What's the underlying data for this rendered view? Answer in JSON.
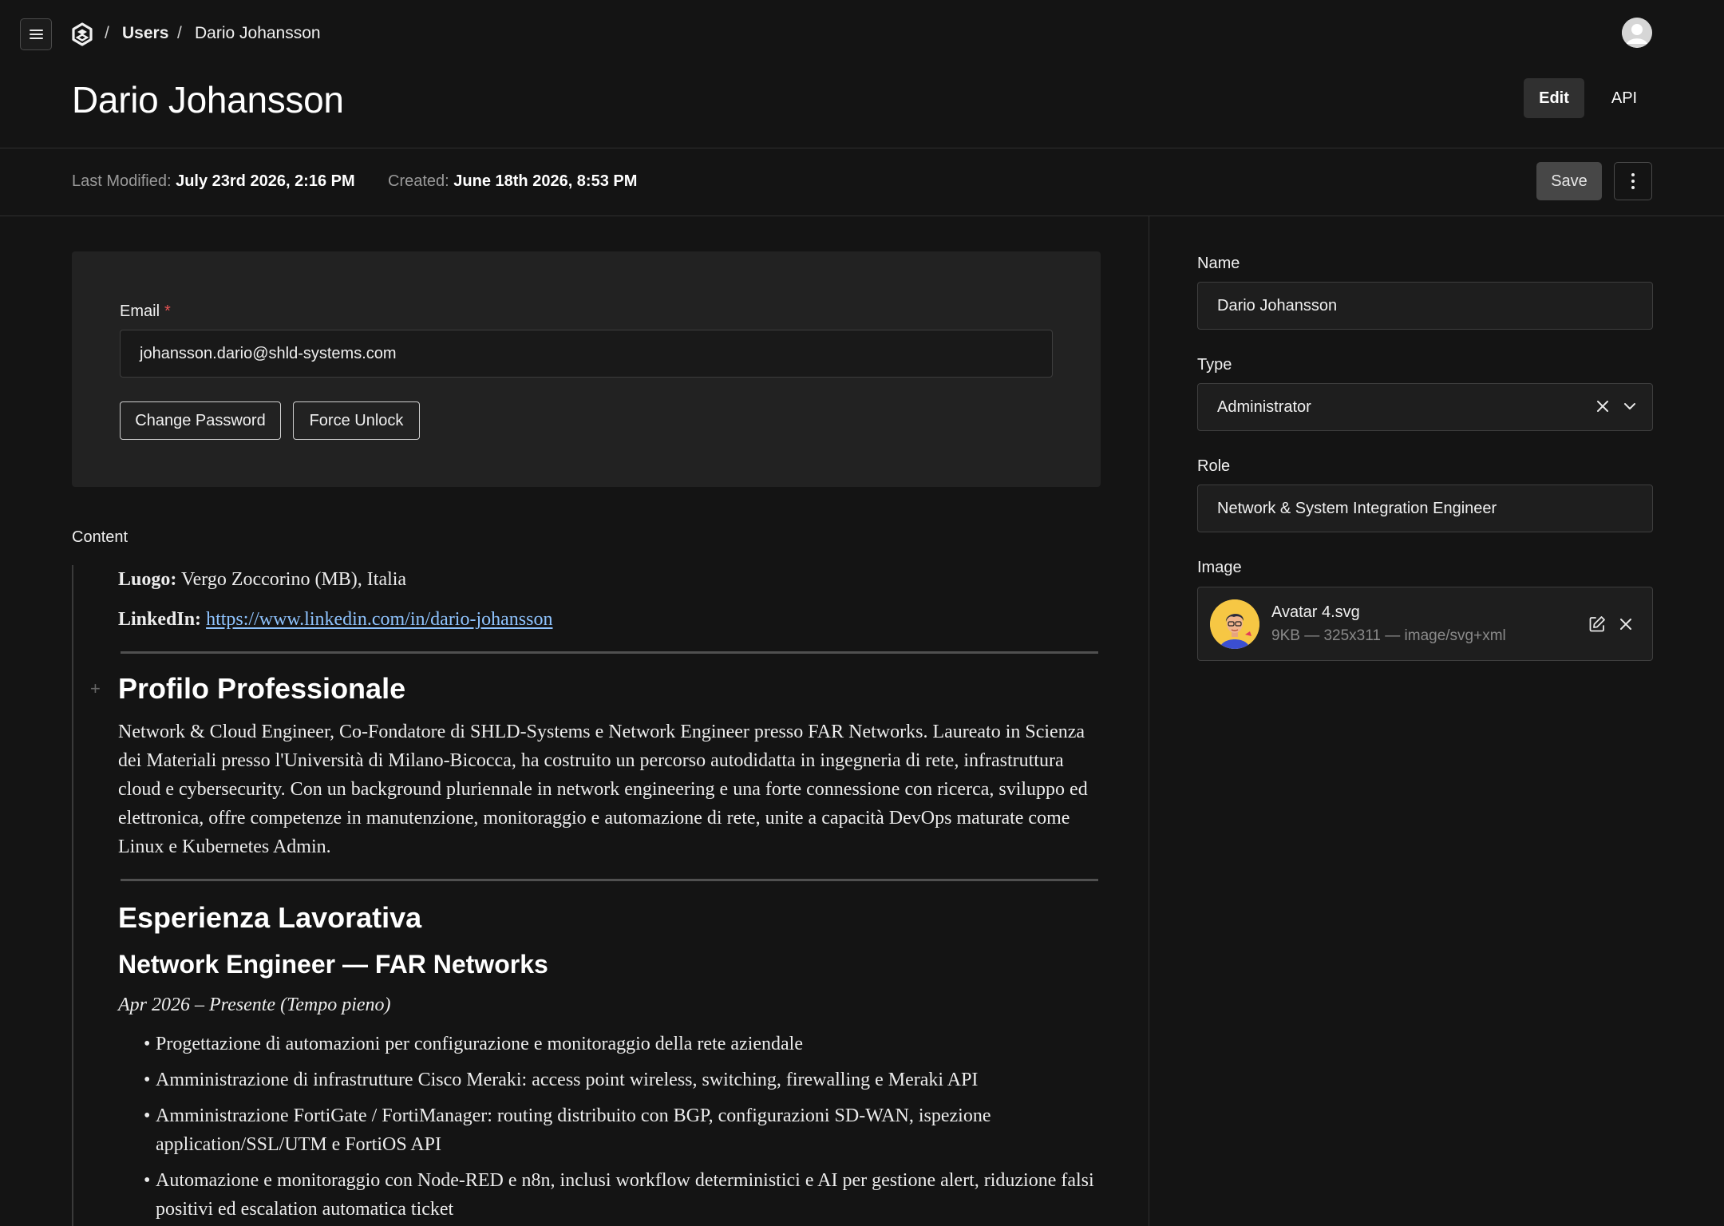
{
  "breadcrumb": {
    "separator": "/",
    "users": "Users",
    "current": "Dario Johansson"
  },
  "header": {
    "title": "Dario Johansson",
    "tabs": {
      "edit": "Edit",
      "api": "API"
    }
  },
  "meta": {
    "last_modified_label": "Last Modified:",
    "last_modified_value": "July 23rd 2026, 2:16 PM",
    "created_label": "Created:",
    "created_value": "June 18th 2026, 8:53 PM",
    "save_label": "Save"
  },
  "email_card": {
    "label": "Email",
    "required_mark": "*",
    "value": "johansson.dario@shld-systems.com",
    "change_password": "Change Password",
    "force_unlock": "Force Unlock"
  },
  "content": {
    "label": "Content",
    "luogo_label": "Luogo:",
    "luogo_value": "Vergo Zoccorino (MB), Italia",
    "linkedin_label": "LinkedIn:",
    "linkedin_url": "https://www.linkedin.com/in/dario-johansson",
    "add_block": "+",
    "profile_heading": "Profilo Professionale",
    "profile_text": "Network & Cloud Engineer, Co-Fondatore di SHLD-Systems e Network Engineer presso FAR Networks. Laureato in Scienza dei Materiali presso l'Università di Milano-Bicocca, ha costruito un percorso autodidatta in ingegneria di rete, infrastruttura cloud e cybersecurity. Con un background pluriennale in network engineering e una forte connessione con ricerca, sviluppo ed elettronica, offre competenze in manutenzione, monitoraggio e automazione di rete, unite a capacità DevOps maturate come Linux e Kubernetes Admin.",
    "experience_heading": "Esperienza Lavorativa",
    "job_title": "Network Engineer — FAR Networks",
    "job_period": "Apr 2026 – Presente (Tempo pieno)",
    "bullets": [
      "Progettazione di automazioni per configurazione e monitoraggio della rete aziendale",
      "Amministrazione di infrastrutture Cisco Meraki: access point wireless, switching, firewalling e Meraki API",
      "Amministrazione FortiGate / FortiManager: routing distribuito con BGP, configurazioni SD-WAN, ispezione application/SSL/UTM e FortiOS API",
      "Automazione e monitoraggio con Node-RED e n8n, inclusi workflow deterministici e AI per gestione alert, riduzione falsi positivi ed escalation automatica ticket"
    ]
  },
  "sidebar": {
    "name_label": "Name",
    "name_value": "Dario Johansson",
    "type_label": "Type",
    "type_value": "Administrator",
    "role_label": "Role",
    "role_value": "Network & System Integration Engineer",
    "image_label": "Image",
    "image_name": "Avatar 4.svg",
    "image_meta": "9KB — 325x311 — image/svg+xml"
  },
  "colors": {
    "background": "#141414",
    "card": "#222222",
    "link": "#8fc4ff",
    "required": "#e55353",
    "avatar_bg": "#f6c744"
  }
}
